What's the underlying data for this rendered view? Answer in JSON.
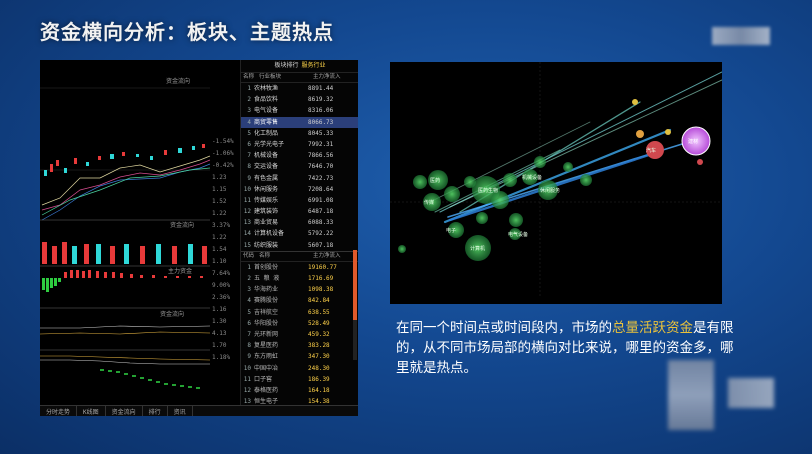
{
  "slide": {
    "title": "资金横向分析：板块、主题热点",
    "description_pre": "在同一个时间点或时间段内，市场的",
    "description_hl": "总量活跃资金",
    "description_post": "是有限的，从不同市场局部的横向对比来说，哪里的资金多，哪里就是热点。"
  },
  "terminal": {
    "price_labels": [
      "-1.54%",
      "-1.06%",
      "-0.42%",
      "1.23",
      "1.15",
      "1.52",
      "1.22",
      "3.37%",
      "1.22",
      "1.54",
      "1.10",
      "7.64%",
      "9.00%",
      "2.36%",
      "1.16",
      "1.30",
      "4.13",
      "1.70",
      "1.18%"
    ],
    "section_labels": [
      "资金流向",
      "资金流向",
      "主力资金",
      "资金流向"
    ],
    "bottom_tabs": [
      "分时走势",
      "K线图",
      "资金流向",
      "排行",
      "资讯"
    ],
    "panel_title_prefix": "板块排行",
    "panel_title_highlight": "服务行业",
    "columns": [
      "名称",
      "行业板块",
      "主力净流入"
    ],
    "top_rows": [
      {
        "n": "1",
        "name": "农林牧渔",
        "val": "8891.44"
      },
      {
        "n": "2",
        "name": "食品饮料",
        "val": "8619.32"
      },
      {
        "n": "3",
        "name": "电气设备",
        "val": "8316.06"
      },
      {
        "n": "4",
        "name": "商贸零售",
        "val": "8066.73"
      },
      {
        "n": "5",
        "name": "化工制品",
        "val": "8045.33"
      },
      {
        "n": "6",
        "name": "光学光电子",
        "val": "7992.31"
      },
      {
        "n": "7",
        "name": "机械设备",
        "val": "7866.56"
      },
      {
        "n": "8",
        "name": "交运设备",
        "val": "7646.70"
      },
      {
        "n": "9",
        "name": "有色金属",
        "val": "7422.73"
      },
      {
        "n": "10",
        "name": "休闲服务",
        "val": "7208.64"
      },
      {
        "n": "11",
        "name": "传媒娱乐",
        "val": "6991.08"
      },
      {
        "n": "12",
        "name": "建筑装饰",
        "val": "6487.18"
      },
      {
        "n": "13",
        "name": "商业贸易",
        "val": "6088.33"
      },
      {
        "n": "14",
        "name": "计算机设备",
        "val": "5792.22"
      },
      {
        "n": "15",
        "name": "纺织服装",
        "val": "5607.18"
      }
    ],
    "sub_columns": [
      "代码",
      "名称",
      "主力净流入"
    ],
    "bottom_rows": [
      {
        "n": "1",
        "name": "首创股份",
        "val": "19160.77"
      },
      {
        "n": "2",
        "name": "五 粮 液",
        "val": "1716.69"
      },
      {
        "n": "3",
        "name": "华海药业",
        "val": "1098.38"
      },
      {
        "n": "4",
        "name": "赛腾股份",
        "val": "842.84"
      },
      {
        "n": "5",
        "name": "吉祥航空",
        "val": "638.55"
      },
      {
        "n": "6",
        "name": "华阳股份",
        "val": "528.49"
      },
      {
        "n": "7",
        "name": "光环新网",
        "val": "459.32"
      },
      {
        "n": "8",
        "name": "复星医药",
        "val": "383.28"
      },
      {
        "n": "9",
        "name": "东方雨虹",
        "val": "347.30"
      },
      {
        "n": "10",
        "name": "中国中冶",
        "val": "248.30"
      },
      {
        "n": "11",
        "name": "口子窖",
        "val": "186.39"
      },
      {
        "n": "12",
        "name": "泰格医药",
        "val": "164.18"
      },
      {
        "n": "13",
        "name": "恒生电子",
        "val": "154.38"
      },
      {
        "n": "14",
        "name": "金种子酒",
        "val": "144.93"
      }
    ]
  },
  "bubble_chart": {
    "x_ticks": [
      "",
      "",
      "",
      "",
      ""
    ],
    "bubble_labels": [
      "医药",
      "医药生物",
      "休闲服务",
      "传媒",
      "电子",
      "计算机",
      "电气设备",
      "机械设备",
      "汽车",
      "建材"
    ]
  },
  "colors": {
    "highlight": "#e9c23c",
    "selected": "#2b3f7a",
    "bg": "#134890"
  }
}
